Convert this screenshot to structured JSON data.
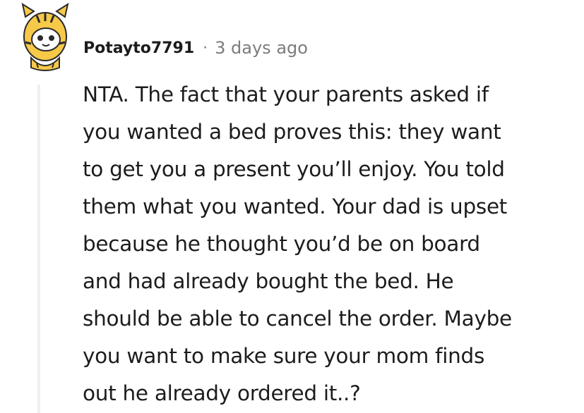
{
  "comment": {
    "username": "Potayto7791",
    "separator": "·",
    "timestamp": "3 days ago",
    "avatar_icon": "snoo-tiger-costume-avatar-icon",
    "body_lines": [
      "NTA. The fact that your parents asked if",
      "you wanted a bed proves this: they want",
      "to get you a present you’ll enjoy. You told",
      "them what you wanted. Your dad is upset",
      "because he thought you’d be on board",
      "and had already bought the bed. He",
      "should be able to cancel the order. Maybe",
      "you want to make sure your mom finds",
      "out he already ordered it..?"
    ]
  },
  "colors": {
    "text": "#1c1c1c",
    "meta_text": "#7c7c7c",
    "thread_line": "#edeff1",
    "avatar_yellow": "#f7c948",
    "avatar_face": "#ffffff"
  }
}
